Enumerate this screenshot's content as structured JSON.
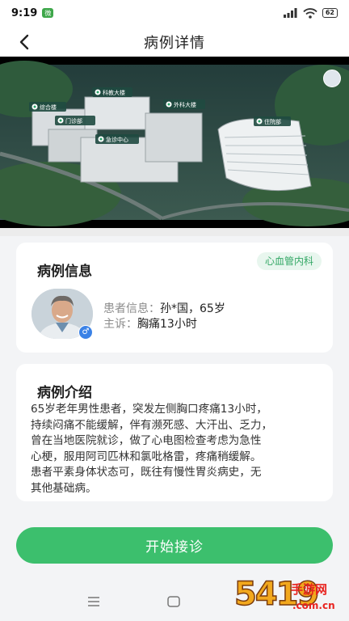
{
  "status_bar": {
    "time": "9:19",
    "app_badge": "微",
    "battery": "62"
  },
  "nav": {
    "title": "病例详情"
  },
  "hero": {
    "building_labels": [
      "科教大楼",
      "综合楼",
      "门诊部",
      "外科大楼",
      "住院部",
      "急诊中心"
    ]
  },
  "case_info": {
    "title": "病例信息",
    "department": "心血管内科",
    "patient_label": "患者信息：",
    "patient_value": "孙*国，65岁",
    "complaint_label": "主诉：",
    "complaint_value": "胸痛13小时",
    "gender_symbol": "♂"
  },
  "case_intro": {
    "title": "病例介绍",
    "lines": [
      "65岁老年男性患者，突发左侧胸口疼痛13小时，",
      "持续闷痛不能缓解，伴有濒死感、大汗出、乏力，",
      "曾在当地医院就诊，做了心电图检查考虑为急性",
      "心梗，服用阿司匹林和氯吡格雷，疼痛稍缓解。",
      "患者平素身体状态可，既往有慢性胃炎病史，无",
      "其他基础病。"
    ]
  },
  "actions": {
    "start_label": "开始接诊"
  },
  "watermark": {
    "number": "5419",
    "name": "手游网",
    "url": ".com.cn"
  },
  "colors": {
    "accent": "#3cbf6d",
    "badge_text": "#34a866",
    "badge_bg": "#e8f6ee"
  }
}
